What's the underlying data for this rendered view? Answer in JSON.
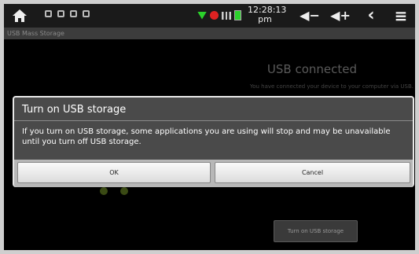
{
  "status_bar": {
    "time": "12:28:13",
    "ampm": "pm",
    "home_icon": "home-icon",
    "notification_icons": [
      "usb-icon",
      "usb-icon",
      "usb-icon",
      "download-icon"
    ],
    "signal_icons": [
      "wifi-icon",
      "alert-icon",
      "signal-bars-icon",
      "battery-icon"
    ],
    "nav_icons": [
      "volume-down-icon",
      "volume-up-icon",
      "back-icon",
      "menu-icon"
    ],
    "glyphs": {
      "volume_down": "◀−",
      "volume_up": "◀+",
      "back": "‹",
      "menu": "≡"
    }
  },
  "window": {
    "title": "USB Mass Storage"
  },
  "background": {
    "heading": "USB connected",
    "description": "You have connected your device to your computer via USB.",
    "turn_on_button": "Turn on USB storage"
  },
  "dialog": {
    "title": "Turn on USB storage",
    "message": "If you turn on USB storage, some applications you are using will stop and may be unavailable until you turn off USB storage.",
    "ok_label": "OK",
    "cancel_label": "Cancel"
  },
  "colors": {
    "accent_green": "#2bd12b",
    "alert_red": "#d22222"
  }
}
